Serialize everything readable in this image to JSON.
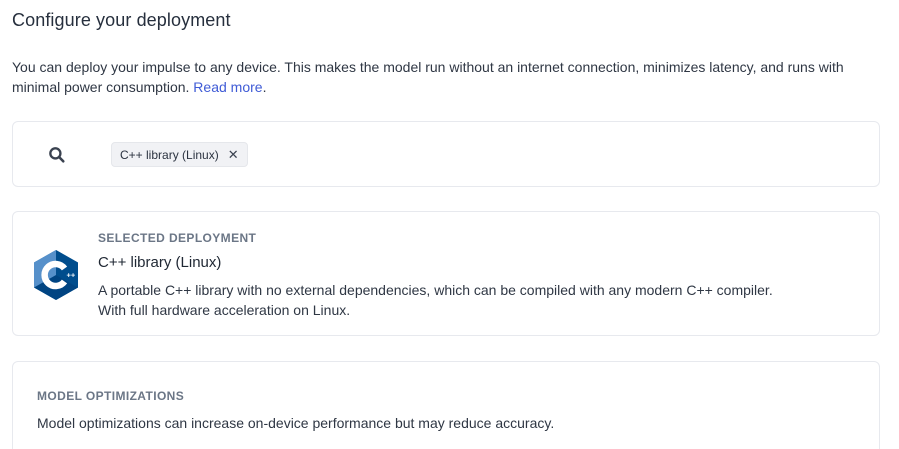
{
  "page": {
    "title": "Configure your deployment",
    "intro_text": "You can deploy your impulse to any device. This makes the model run without an internet connection, minimizes latency, and runs with minimal power consumption. ",
    "read_more_label": "Read more",
    "read_more_suffix": "."
  },
  "search": {
    "icon": "search-icon",
    "selected_chip": "C++ library (Linux)",
    "chip_close": "✕"
  },
  "selected_deployment": {
    "label": "SELECTED DEPLOYMENT",
    "name": "C++ library (Linux)",
    "description_line1": "A portable C++ library with no external dependencies, which can be compiled with any modern C++ compiler.",
    "description_line2": "With full hardware acceleration on Linux.",
    "icon": "cpp-logo-icon",
    "logo_colors": {
      "dark": "#004482",
      "mid": "#00599c",
      "light": "#659ad2"
    }
  },
  "model_optimizations": {
    "label": "MODEL OPTIMIZATIONS",
    "description": "Model optimizations can increase on-device performance but may reduce accuracy."
  }
}
